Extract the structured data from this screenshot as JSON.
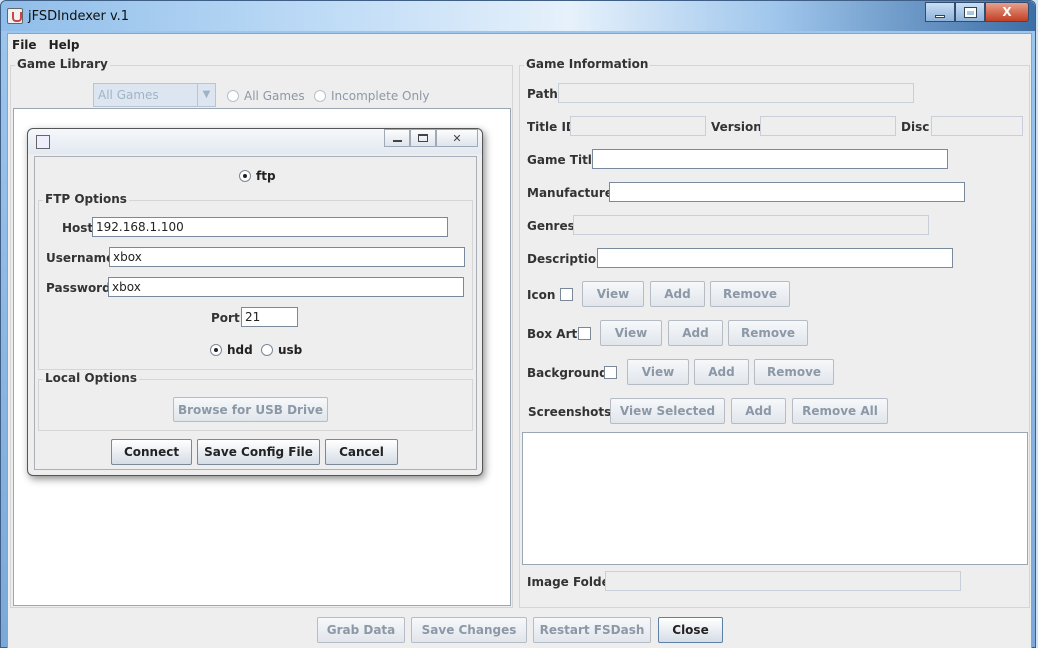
{
  "window": {
    "title": "jFSDIndexer v.1",
    "controls": {
      "minimize": "minimize",
      "maximize": "maximize",
      "close": "X"
    }
  },
  "menu": {
    "file": "File",
    "help": "Help"
  },
  "library": {
    "title": "Game Library",
    "filter_combo": "All Games",
    "radio_all": "All Games",
    "radio_incomplete": "Incomplete Only"
  },
  "info": {
    "title": "Game Information",
    "path": "Path",
    "title_id": "Title ID",
    "version": "Version",
    "disc": "Disc",
    "game_title": "Game Title",
    "manufacturer": "Manufacturer",
    "genres": "Genres",
    "description": "Description",
    "icon": "Icon",
    "box_art": "Box Art",
    "background": "Background",
    "screenshots": "Screenshots",
    "view": "View",
    "add": "Add",
    "remove": "Remove",
    "view_selected": "View Selected",
    "remove_all": "Remove All",
    "image_folder": "Image Folder"
  },
  "footer": {
    "grab_data": "Grab Data",
    "save_changes": "Save Changes",
    "restart": "Restart FSDash",
    "close": "Close"
  },
  "dialog": {
    "mode_ftp": "ftp",
    "ftp_options": "FTP Options",
    "host_label": "Host",
    "host_value": "192.168.1.100",
    "username_label": "Username",
    "username_value": "xbox",
    "password_label": "Password",
    "password_value": "xbox",
    "port_label": "Port",
    "port_value": "21",
    "hdd": "hdd",
    "usb": "usb",
    "local_options": "Local Options",
    "browse_usb": "Browse for USB Drive",
    "connect": "Connect",
    "save_config": "Save Config File",
    "cancel": "Cancel"
  }
}
